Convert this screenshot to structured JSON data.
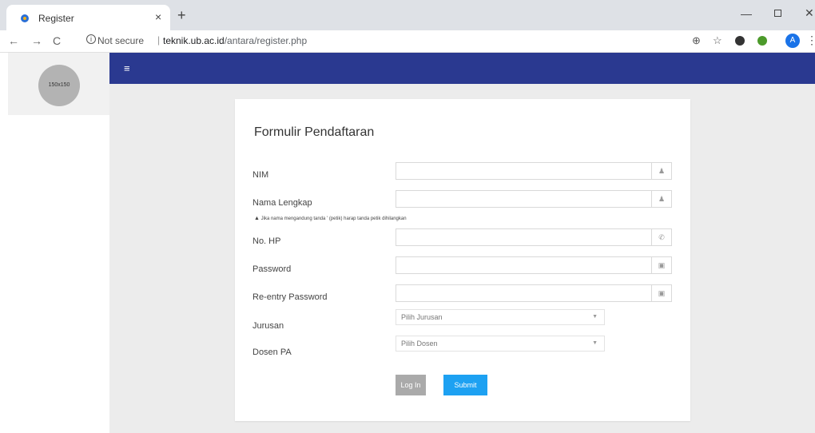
{
  "browser": {
    "tab_title": "Register",
    "tab_close": "×",
    "new_tab": "+",
    "back": "←",
    "forward": "→",
    "reload": "C",
    "security_icon": "i",
    "security_text": "Not secure",
    "url_sep": "|",
    "url_host": "teknik.ub.ac.id",
    "url_path": "/antara/register.php",
    "avatar": "A",
    "menu": "⋮",
    "zoom_icon": "⊕",
    "star_icon": "☆",
    "min": "—",
    "close": "✕"
  },
  "sidebar": {
    "profile_placeholder": "150x150"
  },
  "topbar": {
    "menu_icon": "≡"
  },
  "form": {
    "title": "Formulir Pendaftaran",
    "fields": [
      {
        "label": "NIM",
        "value": "",
        "icon": "user-icon"
      },
      {
        "label": "Nama Lengkap",
        "value": "",
        "icon": "user-icon"
      },
      {
        "label": "No. HP",
        "value": "",
        "icon": "phone-icon"
      },
      {
        "label": "Password",
        "value": "",
        "icon": "lock-icon"
      },
      {
        "label": "Re-entry Password",
        "value": "",
        "icon": "lock-icon"
      }
    ],
    "name_warning": "Jika nama mengandung tanda ' (petik) harap tanda petik dihilangkan",
    "jurusan": {
      "label": "Jurusan",
      "value": "Pilih Jurusan"
    },
    "dosen": {
      "label": "Dosen PA",
      "value": "Pilih Dosen"
    },
    "login_label": "Log In",
    "submit_label": "Submit"
  },
  "colors": {
    "topbar": "#2a3990",
    "submit": "#1da1f2",
    "login": "#aaaaaa"
  }
}
